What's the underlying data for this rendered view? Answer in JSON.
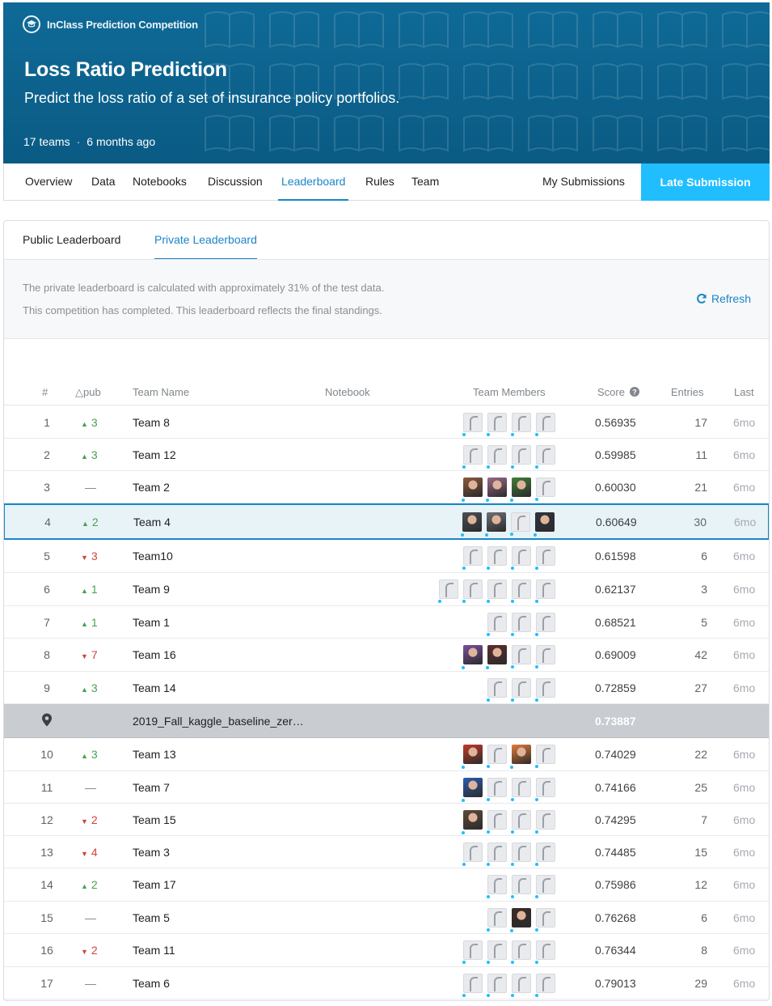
{
  "banner": {
    "badge": "InClass Prediction Competition",
    "title": "Loss Ratio Prediction",
    "subtitle": "Predict the loss ratio of a set of insurance policy portfolios.",
    "teams": "17 teams",
    "age": "6 months ago",
    "dot": "·"
  },
  "nav": {
    "tabs": [
      "Overview",
      "Data",
      "Notebooks",
      "Discussion",
      "Leaderboard",
      "Rules",
      "Team"
    ],
    "active": "Leaderboard",
    "my_submissions": "My Submissions",
    "late_submission": "Late Submission"
  },
  "leaderboard": {
    "tabs": [
      "Public Leaderboard",
      "Private Leaderboard"
    ],
    "notice_1": "The private leaderboard is calculated with approximately 31% of the test data.",
    "notice_2": "This competition has completed. This leaderboard reflects the final standings.",
    "refresh": "Refresh",
    "headers": {
      "rank": "#",
      "delta": "△pub",
      "team": "Team Name",
      "notebook": "Notebook",
      "members": "Team Members",
      "score": "Score",
      "entries": "Entries",
      "last": "Last"
    },
    "rows": [
      {
        "rank": "1",
        "dir": "up",
        "delta": "3",
        "team": "Team 8",
        "score": "0.56935",
        "entries": "17",
        "last": "6mo",
        "avatars": [
          "d",
          "d",
          "d",
          "d"
        ]
      },
      {
        "rank": "2",
        "dir": "up",
        "delta": "3",
        "team": "Team 12",
        "score": "0.59985",
        "entries": "11",
        "last": "6mo",
        "avatars": [
          "d",
          "d",
          "d",
          "d"
        ]
      },
      {
        "rank": "3",
        "dir": "none",
        "delta": "—",
        "team": "Team 2",
        "score": "0.60030",
        "entries": "21",
        "last": "6mo",
        "avatars": [
          "p1",
          "p2",
          "p3",
          "d"
        ]
      },
      {
        "rank": "4",
        "dir": "up",
        "delta": "2",
        "team": "Team 4",
        "score": "0.60649",
        "entries": "30",
        "last": "6mo",
        "avatars": [
          "p4",
          "p5",
          "d",
          "p6"
        ],
        "selected": true
      },
      {
        "rank": "5",
        "dir": "down",
        "delta": "3",
        "team": "Team10",
        "score": "0.61598",
        "entries": "6",
        "last": "6mo",
        "avatars": [
          "d",
          "d",
          "d",
          "d"
        ]
      },
      {
        "rank": "6",
        "dir": "up",
        "delta": "1",
        "team": "Team 9",
        "score": "0.62137",
        "entries": "3",
        "last": "6mo",
        "avatars": [
          "d",
          "d",
          "d",
          "d",
          "d"
        ]
      },
      {
        "rank": "7",
        "dir": "up",
        "delta": "1",
        "team": "Team 1",
        "score": "0.68521",
        "entries": "5",
        "last": "6mo",
        "avatars": [
          "d",
          "d",
          "d"
        ]
      },
      {
        "rank": "8",
        "dir": "down",
        "delta": "7",
        "team": "Team 16",
        "score": "0.69009",
        "entries": "42",
        "last": "6mo",
        "avatars": [
          "p7",
          "p8",
          "d",
          "d"
        ]
      },
      {
        "rank": "9",
        "dir": "up",
        "delta": "3",
        "team": "Team 14",
        "score": "0.72859",
        "entries": "27",
        "last": "6mo",
        "avatars": [
          "d",
          "d",
          "d"
        ]
      },
      {
        "rank": "",
        "dir": "pin",
        "delta": "",
        "team": "2019_Fall_kaggle_baseline_zer…",
        "score": "0.73887",
        "entries": "",
        "last": "",
        "avatars": [],
        "baseline": true
      },
      {
        "rank": "10",
        "dir": "up",
        "delta": "3",
        "team": "Team 13",
        "score": "0.74029",
        "entries": "22",
        "last": "6mo",
        "avatars": [
          "p9",
          "d",
          "p10",
          "d"
        ]
      },
      {
        "rank": "11",
        "dir": "none",
        "delta": "—",
        "team": "Team 7",
        "score": "0.74166",
        "entries": "25",
        "last": "6mo",
        "avatars": [
          "p11",
          "d",
          "d",
          "d"
        ]
      },
      {
        "rank": "12",
        "dir": "down",
        "delta": "2",
        "team": "Team 15",
        "score": "0.74295",
        "entries": "7",
        "last": "6mo",
        "avatars": [
          "p12",
          "d",
          "d",
          "d"
        ]
      },
      {
        "rank": "13",
        "dir": "down",
        "delta": "4",
        "team": "Team 3",
        "score": "0.74485",
        "entries": "15",
        "last": "6mo",
        "avatars": [
          "d",
          "d",
          "d",
          "d"
        ]
      },
      {
        "rank": "14",
        "dir": "up",
        "delta": "2",
        "team": "Team 17",
        "score": "0.75986",
        "entries": "12",
        "last": "6mo",
        "avatars": [
          "d",
          "d",
          "d"
        ]
      },
      {
        "rank": "15",
        "dir": "none",
        "delta": "—",
        "team": "Team 5",
        "score": "0.76268",
        "entries": "6",
        "last": "6mo",
        "avatars": [
          "d",
          "p13",
          "d"
        ]
      },
      {
        "rank": "16",
        "dir": "down",
        "delta": "2",
        "team": "Team 11",
        "score": "0.76344",
        "entries": "8",
        "last": "6mo",
        "avatars": [
          "d",
          "d",
          "d",
          "d"
        ]
      },
      {
        "rank": "17",
        "dir": "none",
        "delta": "—",
        "team": "Team 6",
        "score": "0.79013",
        "entries": "29",
        "last": "6mo",
        "avatars": [
          "d",
          "d",
          "d",
          "d"
        ]
      }
    ]
  },
  "colors": {
    "banner": "#0c6591",
    "accent": "#1a86c7",
    "late_button": "#20beff",
    "up": "#48a04f",
    "down": "#d0443a",
    "baseline_row": "#c9ccd0",
    "photo_palette": {
      "p1": "#8a5a3c",
      "p2": "#9a6a8a",
      "p3": "#3f7d3a",
      "p4": "#4a4e55",
      "p5": "#6d7077",
      "p6": "#2f3340",
      "p7": "#7a4fa0",
      "p8": "#5a2e2e",
      "p9": "#c0392b",
      "p10": "#e07b39",
      "p11": "#2a5db0",
      "p12": "#5b4a3a",
      "p13": "#3a2a2a"
    }
  },
  "icons": {
    "badge": "graduation-cap-icon",
    "refresh": "refresh-icon",
    "help": "question-circle-icon",
    "pin": "location-pin-icon"
  }
}
